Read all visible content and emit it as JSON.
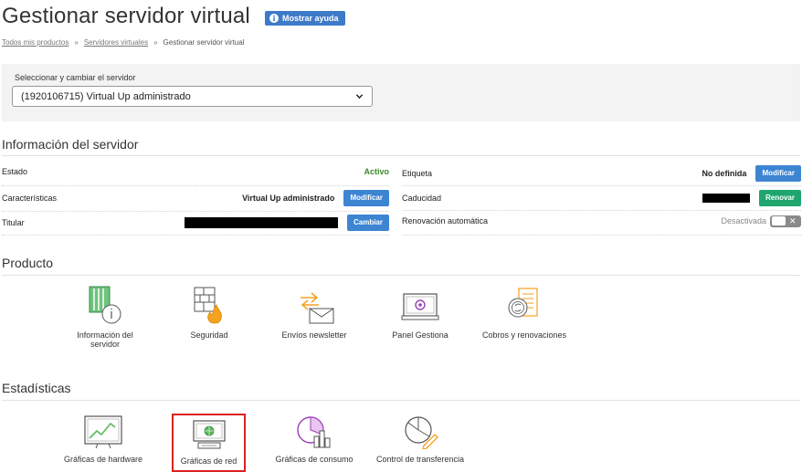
{
  "header": {
    "title": "Gestionar servidor virtual",
    "help_label": "Mostrar ayuda"
  },
  "breadcrumb": {
    "items": [
      "Todos mis productos",
      "Servidores virtuales",
      "Gestionar servidor virtual"
    ],
    "separator": "»"
  },
  "server_selector": {
    "label": "Seleccionar y cambiar el servidor",
    "value": "(1920106715) Virtual Up administrado"
  },
  "info": {
    "title": "Información del servidor",
    "estado_label": "Estado",
    "estado_value": "Activo",
    "caracteristicas_label": "Características",
    "caracteristicas_value": "Virtual Up administrado",
    "caracteristicas_btn": "Modificar",
    "titular_label": "Titular",
    "titular_btn": "Cambiar",
    "etiqueta_label": "Etiqueta",
    "etiqueta_value": "No definida",
    "etiqueta_btn": "Modificar",
    "caducidad_label": "Caducidad",
    "caducidad_btn": "Renovar",
    "renovacion_label": "Renovación automática",
    "renovacion_value": "Desactivada",
    "toggle_x": "✕"
  },
  "producto": {
    "title": "Producto",
    "items": [
      {
        "label": "Información del servidor",
        "icon": "server-info-icon"
      },
      {
        "label": "Seguridad",
        "icon": "firewall-icon"
      },
      {
        "label": "Envíos newsletter",
        "icon": "newsletter-icon"
      },
      {
        "label": "Panel Gestiona",
        "icon": "panel-monitor-icon"
      },
      {
        "label": "Cobros y renovaciones",
        "icon": "billing-icon"
      }
    ]
  },
  "estadisticas": {
    "title": "Estadísticas",
    "items": [
      {
        "label": "Gráficas de hardware",
        "icon": "hardware-chart-icon"
      },
      {
        "label": "Gráficas de red",
        "icon": "network-chart-icon"
      },
      {
        "label": "Gráficas de consumo",
        "icon": "consumption-chart-icon"
      },
      {
        "label": "Control de transferencia",
        "icon": "transfer-control-icon"
      }
    ]
  },
  "colors": {
    "accent_blue": "#3d85d2",
    "accent_green": "#1fa66e",
    "status_green": "#3a8a2a",
    "icon_orange": "#f5a21e",
    "icon_green": "#5cb85c",
    "icon_purple": "#9b3fb5",
    "highlight_red": "#d22222"
  }
}
